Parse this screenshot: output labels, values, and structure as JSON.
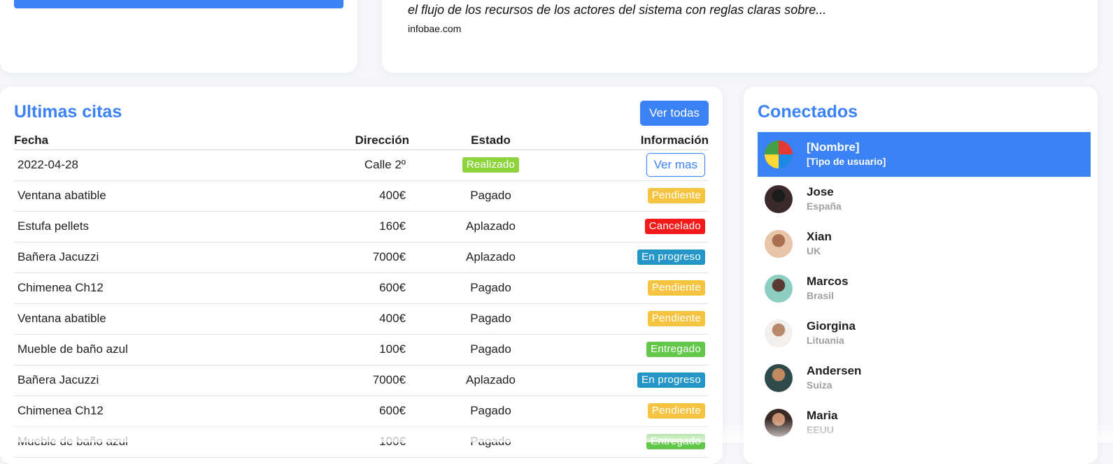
{
  "news": {
    "excerpt": "el flujo de los recursos de los actores del sistema con reglas claras sobre...",
    "source": "infobae.com"
  },
  "citas": {
    "title": "Ultimas citas",
    "view_all_label": "Ver todas",
    "columns": [
      "Fecha",
      "Dirección",
      "Estado",
      "Información"
    ],
    "rows": [
      {
        "fecha": "2022-04-28",
        "direccion": "Calle 2º",
        "estado": "Realizado",
        "estado_type": "badge",
        "estado_color": "#8fd33f",
        "info": "Ver mas",
        "info_type": "button",
        "info_color": "#3b82f6"
      },
      {
        "fecha": "Ventana abatible",
        "direccion": "400€",
        "estado": "Pagado",
        "estado_type": "text",
        "info": "Pendiente",
        "info_type": "badge",
        "info_color": "#f5c542"
      },
      {
        "fecha": "Estufa pellets",
        "direccion": "160€",
        "estado": "Aplazado",
        "estado_type": "text",
        "info": "Cancelado",
        "info_type": "badge",
        "info_color": "#f51a1a"
      },
      {
        "fecha": "Bañera Jacuzzi",
        "direccion": "7000€",
        "estado": "Aplazado",
        "estado_type": "text",
        "info": "En progreso",
        "info_type": "badge",
        "info_color": "#2596c8"
      },
      {
        "fecha": "Chimenea Ch12",
        "direccion": "600€",
        "estado": "Pagado",
        "estado_type": "text",
        "info": "Pendiente",
        "info_type": "badge",
        "info_color": "#f5c542"
      },
      {
        "fecha": "Ventana abatible",
        "direccion": "400€",
        "estado": "Pagado",
        "estado_type": "text",
        "info": "Pendiente",
        "info_type": "badge",
        "info_color": "#f5c542"
      },
      {
        "fecha": "Mueble de baño azul",
        "direccion": "100€",
        "estado": "Pagado",
        "estado_type": "text",
        "info": "Entregado",
        "info_type": "badge",
        "info_color": "#63c84a"
      },
      {
        "fecha": "Bañera Jacuzzi",
        "direccion": "7000€",
        "estado": "Aplazado",
        "estado_type": "text",
        "info": "En progreso",
        "info_type": "badge",
        "info_color": "#2596c8"
      },
      {
        "fecha": "Chimenea Ch12",
        "direccion": "600€",
        "estado": "Pagado",
        "estado_type": "text",
        "info": "Pendiente",
        "info_type": "badge",
        "info_color": "#f5c542"
      },
      {
        "fecha": "Mueble de baño azul",
        "direccion": "100€",
        "estado": "Pagado",
        "estado_type": "text",
        "info": "Entregado",
        "info_type": "badge",
        "info_color": "#63c84a"
      }
    ]
  },
  "conectados": {
    "title": "Conectados",
    "users": [
      {
        "name": "[Nombre]",
        "sub": "[Tipo de usuario]",
        "active": true,
        "avatar_colors": [
          "#e53935",
          "#1e88e5",
          "#fdd835",
          "#43a047"
        ]
      },
      {
        "name": "Jose",
        "sub": "España",
        "active": false,
        "avatar_colors": [
          "#3a2a2a",
          "#1b1b1b"
        ]
      },
      {
        "name": "Xian",
        "sub": "UK",
        "active": false,
        "avatar_colors": [
          "#e8c4a8",
          "#a8704e"
        ]
      },
      {
        "name": "Marcos",
        "sub": "Brasil",
        "active": false,
        "avatar_colors": [
          "#8ccfc0",
          "#5a3a30"
        ]
      },
      {
        "name": "Giorgina",
        "sub": "Lituania",
        "active": false,
        "avatar_colors": [
          "#f3efec",
          "#b98a6a"
        ]
      },
      {
        "name": "Andersen",
        "sub": "Suiza",
        "active": false,
        "avatar_colors": [
          "#2f4a4a",
          "#c08a60"
        ]
      },
      {
        "name": "Maria",
        "sub": "EEUU",
        "active": false,
        "avatar_colors": [
          "#3a2a25",
          "#c89070"
        ]
      }
    ]
  },
  "colors": {
    "accent": "#3b82f6",
    "background": "#f4f6fa"
  }
}
